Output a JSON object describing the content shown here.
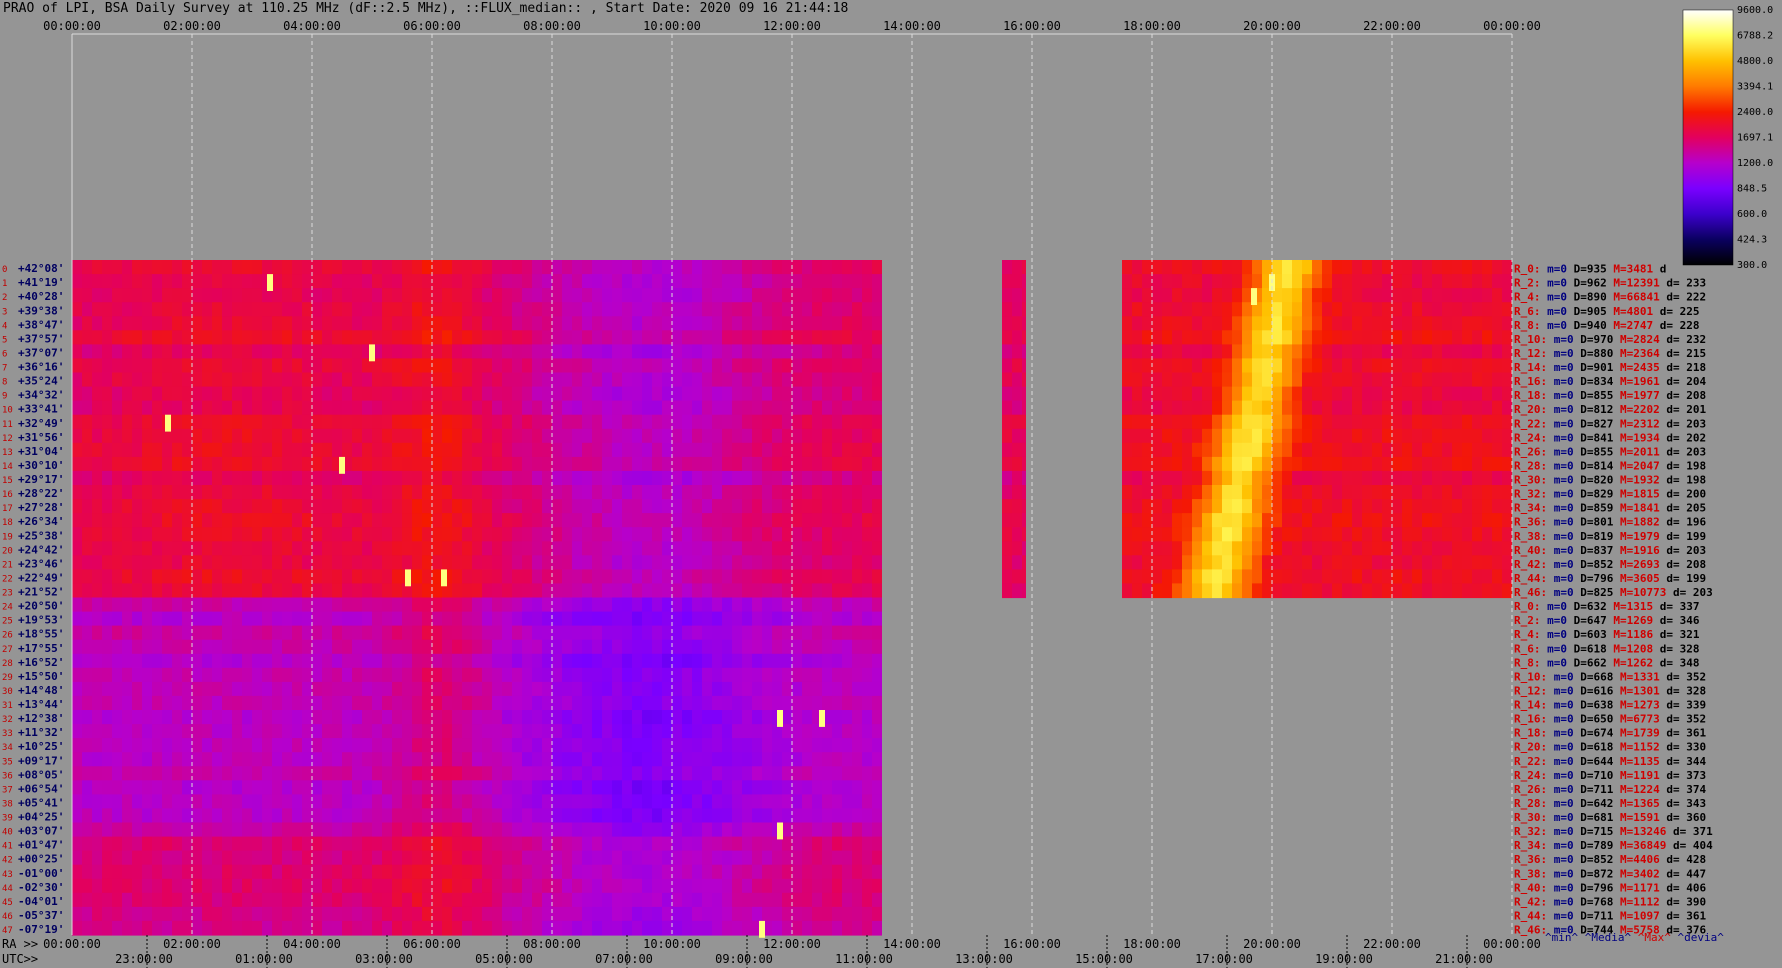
{
  "title": "PRAO of LPI, BSA Daily Survey at 110.25 MHz (dF::2.5 MHz), ::FLUX_median:: , Start Date: 2020 09 16 21:44:18",
  "chart_data": {
    "type": "heatmap",
    "x_axis_top_ticks": [
      "00:00:00",
      "02:00:00",
      "04:00:00",
      "06:00:00",
      "08:00:00",
      "10:00:00",
      "12:00:00",
      "14:00:00",
      "16:00:00",
      "18:00:00",
      "20:00:00",
      "22:00:00",
      "00:00:00"
    ],
    "ra_label": "RA >>",
    "ra_ticks": [
      "00:00:00",
      "02:00:00",
      "04:00:00",
      "06:00:00",
      "08:00:00",
      "10:00:00",
      "12:00:00",
      "14:00:00",
      "16:00:00",
      "18:00:00",
      "20:00:00",
      "22:00:00",
      "00:00:00"
    ],
    "utc_label": "UTC>>",
    "utc_ticks": [
      "23:00:00",
      "01:00:00",
      "03:00:00",
      "05:00:00",
      "07:00:00",
      "09:00:00",
      "11:00:00",
      "13:00:00",
      "15:00:00",
      "17:00:00",
      "19:00:00",
      "21:00:00"
    ],
    "colorbar": {
      "ticks": [
        "9600.0",
        "6788.2",
        "4800.0",
        "3394.1",
        "2400.0",
        "1697.1",
        "1200.0",
        "848.5",
        "600.0",
        "424.3",
        "300.0"
      ],
      "colors": [
        "#ffffff",
        "#ffff60",
        "#ffc000",
        "#ff7a00",
        "#f51a00",
        "#e3005e",
        "#b600cc",
        "#7a00ff",
        "#3c00cc",
        "#0a0060",
        "#000000"
      ]
    },
    "declinations": [
      "+42°08'",
      "+41°19'",
      "+40°28'",
      "+39°38'",
      "+38°47'",
      "+37°57'",
      "+37°07'",
      "+36°16'",
      "+35°24'",
      "+34°32'",
      "+33°41'",
      "+32°49'",
      "+31°56'",
      "+31°04'",
      "+30°10'",
      "+29°17'",
      "+28°22'",
      "+27°28'",
      "+26°34'",
      "+25°38'",
      "+24°42'",
      "+23°46'",
      "+22°49'",
      "+21°52'",
      "+20°50'",
      "+19°53'",
      "+18°55'",
      "+17°55'",
      "+16°52'",
      "+15°50'",
      "+14°48'",
      "+13°44'",
      "+12°38'",
      "+11°32'",
      "+10°25'",
      "+09°17'",
      "+08°05'",
      "+06°54'",
      "+05°41'",
      "+04°25'",
      "+03°07'",
      "+01°47'",
      "+00°25'",
      "-01°00'",
      "-02°30'",
      "-04°01'",
      "-05°37'",
      "-07°19'"
    ],
    "stats_rows": [
      {
        "r": "R_0:",
        "m": "m=0",
        "d": "D=935",
        "max": "M=3481",
        "dev": "d"
      },
      {
        "r": "R_2:",
        "m": "m=0",
        "d": "D=962",
        "max": "M=12391",
        "dev": "d= 233"
      },
      {
        "r": "R_4:",
        "m": "m=0",
        "d": "D=890",
        "max": "M=66841",
        "dev": "d= 222"
      },
      {
        "r": "R_6:",
        "m": "m=0",
        "d": "D=905",
        "max": "M=4801",
        "dev": "d= 225"
      },
      {
        "r": "R_8:",
        "m": "m=0",
        "d": "D=940",
        "max": "M=2747",
        "dev": "d= 228"
      },
      {
        "r": "R_10:",
        "m": "m=0",
        "d": "D=970",
        "max": "M=2824",
        "dev": "d= 232"
      },
      {
        "r": "R_12:",
        "m": "m=0",
        "d": "D=880",
        "max": "M=2364",
        "dev": "d= 215"
      },
      {
        "r": "R_14:",
        "m": "m=0",
        "d": "D=901",
        "max": "M=2435",
        "dev": "d= 218"
      },
      {
        "r": "R_16:",
        "m": "m=0",
        "d": "D=834",
        "max": "M=1961",
        "dev": "d= 204"
      },
      {
        "r": "R_18:",
        "m": "m=0",
        "d": "D=855",
        "max": "M=1977",
        "dev": "d= 208"
      },
      {
        "r": "R_20:",
        "m": "m=0",
        "d": "D=812",
        "max": "M=2202",
        "dev": "d= 201"
      },
      {
        "r": "R_22:",
        "m": "m=0",
        "d": "D=827",
        "max": "M=2312",
        "dev": "d= 203"
      },
      {
        "r": "R_24:",
        "m": "m=0",
        "d": "D=841",
        "max": "M=1934",
        "dev": "d= 202"
      },
      {
        "r": "R_26:",
        "m": "m=0",
        "d": "D=855",
        "max": "M=2011",
        "dev": "d= 203"
      },
      {
        "r": "R_28:",
        "m": "m=0",
        "d": "D=814",
        "max": "M=2047",
        "dev": "d= 198"
      },
      {
        "r": "R_30:",
        "m": "m=0",
        "d": "D=820",
        "max": "M=1932",
        "dev": "d= 198"
      },
      {
        "r": "R_32:",
        "m": "m=0",
        "d": "D=829",
        "max": "M=1815",
        "dev": "d= 200"
      },
      {
        "r": "R_34:",
        "m": "m=0",
        "d": "D=859",
        "max": "M=1841",
        "dev": "d= 205"
      },
      {
        "r": "R_36:",
        "m": "m=0",
        "d": "D=801",
        "max": "M=1882",
        "dev": "d= 196"
      },
      {
        "r": "R_38:",
        "m": "m=0",
        "d": "D=819",
        "max": "M=1979",
        "dev": "d= 199"
      },
      {
        "r": "R_40:",
        "m": "m=0",
        "d": "D=837",
        "max": "M=1916",
        "dev": "d= 203"
      },
      {
        "r": "R_42:",
        "m": "m=0",
        "d": "D=852",
        "max": "M=2693",
        "dev": "d= 208"
      },
      {
        "r": "R_44:",
        "m": "m=0",
        "d": "D=796",
        "max": "M=3605",
        "dev": "d= 199"
      },
      {
        "r": "R_46:",
        "m": "m=0",
        "d": "D=825",
        "max": "M=10773",
        "dev": "d= 203"
      },
      {
        "r": "R_0:",
        "m": "m=0",
        "d": "D=632",
        "max": "M=1315",
        "dev": "d= 337"
      },
      {
        "r": "R_2:",
        "m": "m=0",
        "d": "D=647",
        "max": "M=1269",
        "dev": "d= 346"
      },
      {
        "r": "R_4:",
        "m": "m=0",
        "d": "D=603",
        "max": "M=1186",
        "dev": "d= 321"
      },
      {
        "r": "R_6:",
        "m": "m=0",
        "d": "D=618",
        "max": "M=1208",
        "dev": "d= 328"
      },
      {
        "r": "R_8:",
        "m": "m=0",
        "d": "D=662",
        "max": "M=1262",
        "dev": "d= 348"
      },
      {
        "r": "R_10:",
        "m": "m=0",
        "d": "D=668",
        "max": "M=1331",
        "dev": "d= 352"
      },
      {
        "r": "R_12:",
        "m": "m=0",
        "d": "D=616",
        "max": "M=1301",
        "dev": "d= 328"
      },
      {
        "r": "R_14:",
        "m": "m=0",
        "d": "D=638",
        "max": "M=1273",
        "dev": "d= 339"
      },
      {
        "r": "R_16:",
        "m": "m=0",
        "d": "D=650",
        "max": "M=6773",
        "dev": "d= 352"
      },
      {
        "r": "R_18:",
        "m": "m=0",
        "d": "D=674",
        "max": "M=1739",
        "dev": "d= 361"
      },
      {
        "r": "R_20:",
        "m": "m=0",
        "d": "D=618",
        "max": "M=1152",
        "dev": "d= 330"
      },
      {
        "r": "R_22:",
        "m": "m=0",
        "d": "D=644",
        "max": "M=1135",
        "dev": "d= 344"
      },
      {
        "r": "R_24:",
        "m": "m=0",
        "d": "D=710",
        "max": "M=1191",
        "dev": "d= 373"
      },
      {
        "r": "R_26:",
        "m": "m=0",
        "d": "D=711",
        "max": "M=1224",
        "dev": "d= 374"
      },
      {
        "r": "R_28:",
        "m": "m=0",
        "d": "D=642",
        "max": "M=1365",
        "dev": "d= 343"
      },
      {
        "r": "R_30:",
        "m": "m=0",
        "d": "D=681",
        "max": "M=1591",
        "dev": "d= 360"
      },
      {
        "r": "R_32:",
        "m": "m=0",
        "d": "D=715",
        "max": "M=13246",
        "dev": "d= 371"
      },
      {
        "r": "R_34:",
        "m": "m=0",
        "d": "D=789",
        "max": "M=36849",
        "dev": "d= 404"
      },
      {
        "r": "R_36:",
        "m": "m=0",
        "d": "D=852",
        "max": "M=4406",
        "dev": "d= 428"
      },
      {
        "r": "R_38:",
        "m": "m=0",
        "d": "D=872",
        "max": "M=3402",
        "dev": "d= 447"
      },
      {
        "r": "R_40:",
        "m": "m=0",
        "d": "D=796",
        "max": "M=1171",
        "dev": "d= 406"
      },
      {
        "r": "R_42:",
        "m": "m=0",
        "d": "D=768",
        "max": "M=1112",
        "dev": "d= 390"
      },
      {
        "r": "R_44:",
        "m": "m=0",
        "d": "D=711",
        "max": "M=1097",
        "dev": "d= 361"
      },
      {
        "r": "R_46:",
        "m": "m=0",
        "d": "D=744",
        "max": "M=5758",
        "dev": "d= 376"
      }
    ],
    "stats_footer": {
      "min": "^min^",
      "median": "^Media^",
      "max": "^Max^",
      "devia": "^devia^"
    },
    "colors": {
      "background": "#959595",
      "grid": "#dcdcdc",
      "left_index": "#c00000",
      "dec_label": "#000060",
      "stat_red": "#d00000",
      "stat_blue": "#000080",
      "stat_black": "#000000"
    }
  }
}
